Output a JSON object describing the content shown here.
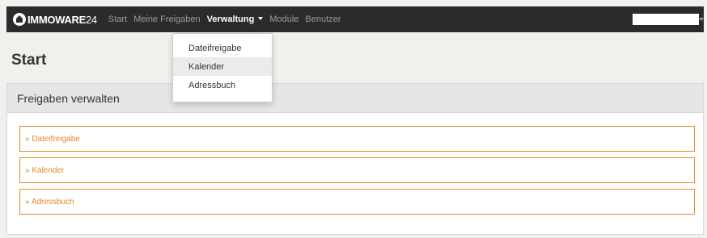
{
  "brand": {
    "name": "IMMOWARE",
    "number": "24"
  },
  "nav": {
    "items": [
      {
        "label": "Start"
      },
      {
        "label": "Meine Freigaben"
      },
      {
        "label": "Verwaltung"
      },
      {
        "label": "Module"
      },
      {
        "label": "Benutzer"
      }
    ],
    "active": "Verwaltung"
  },
  "dropdown": {
    "items": [
      {
        "label": "Dateifreigabe"
      },
      {
        "label": "Kalender"
      },
      {
        "label": "Adressbuch"
      }
    ],
    "highlighted": "Kalender"
  },
  "page": {
    "title": "Start"
  },
  "panel": {
    "heading": "Freigaben verwalten",
    "links": [
      {
        "label": "» Dateifreigabe"
      },
      {
        "label": "» Kalender"
      },
      {
        "label": "» Adressbuch"
      }
    ]
  },
  "colors": {
    "navbar": "#2b2b2b",
    "accent": "#e08a2a",
    "panel_heading": "#e6e6e6"
  },
  "icons": {
    "logo": "immoware-house-icon",
    "user_caret": "chevron-down-icon"
  }
}
